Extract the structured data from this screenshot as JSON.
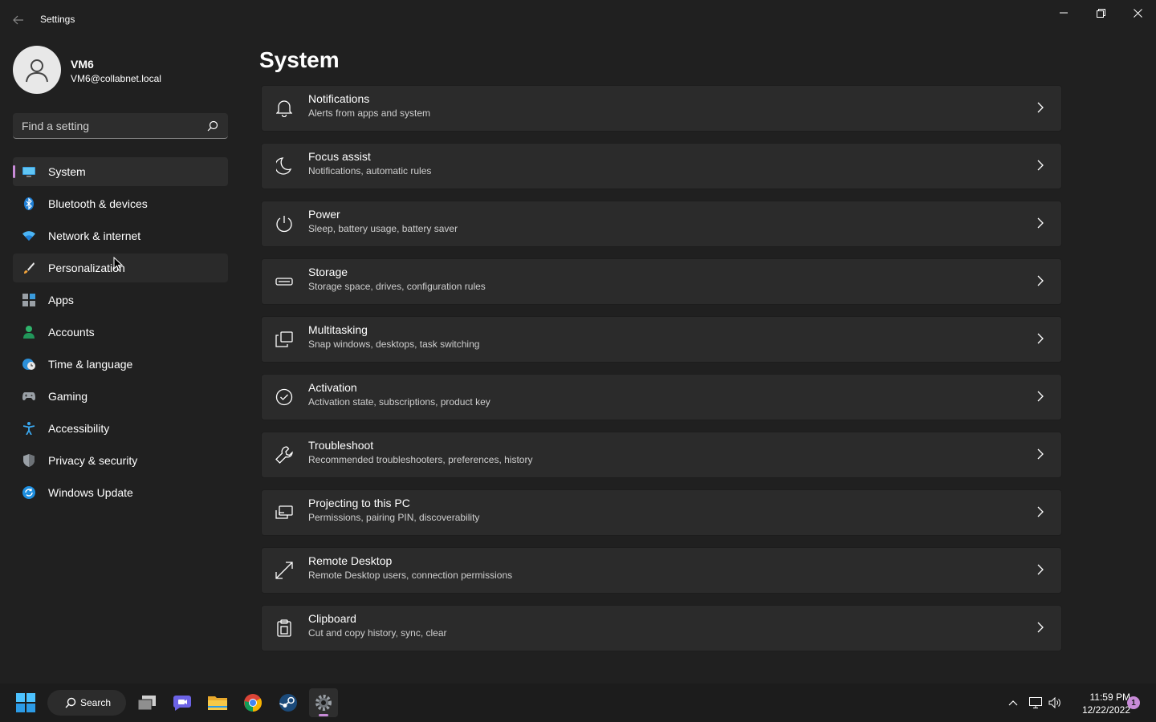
{
  "window": {
    "title": "Settings",
    "back_icon": "arrow-left-icon",
    "controls": [
      "minimize-icon",
      "restore-icon",
      "close-icon"
    ]
  },
  "user": {
    "name": "VM6",
    "email": "VM6@collabnet.local",
    "avatar_icon": "person-icon"
  },
  "search": {
    "placeholder": "Find a setting",
    "value": "",
    "icon": "search-icon"
  },
  "sidebar": {
    "selected": "System",
    "items": [
      {
        "label": "System",
        "icon": "monitor-icon"
      },
      {
        "label": "Bluetooth & devices",
        "icon": "bluetooth-icon"
      },
      {
        "label": "Network & internet",
        "icon": "wifi-icon"
      },
      {
        "label": "Personalization",
        "icon": "brush-icon"
      },
      {
        "label": "Apps",
        "icon": "apps-icon"
      },
      {
        "label": "Accounts",
        "icon": "account-icon"
      },
      {
        "label": "Time & language",
        "icon": "globe-clock-icon"
      },
      {
        "label": "Gaming",
        "icon": "gamepad-icon"
      },
      {
        "label": "Accessibility",
        "icon": "accessibility-icon"
      },
      {
        "label": "Privacy & security",
        "icon": "shield-icon"
      },
      {
        "label": "Windows Update",
        "icon": "update-icon"
      }
    ]
  },
  "main": {
    "title": "System",
    "cards": [
      {
        "title": "Notifications",
        "subtitle": "Alerts from apps and system",
        "icon": "bell-icon"
      },
      {
        "title": "Focus assist",
        "subtitle": "Notifications, automatic rules",
        "icon": "moon-icon"
      },
      {
        "title": "Power",
        "subtitle": "Sleep, battery usage, battery saver",
        "icon": "power-icon"
      },
      {
        "title": "Storage",
        "subtitle": "Storage space, drives, configuration rules",
        "icon": "storage-icon"
      },
      {
        "title": "Multitasking",
        "subtitle": "Snap windows, desktops, task switching",
        "icon": "multitasking-icon"
      },
      {
        "title": "Activation",
        "subtitle": "Activation state, subscriptions, product key",
        "icon": "check-circle-icon"
      },
      {
        "title": "Troubleshoot",
        "subtitle": "Recommended troubleshooters, preferences, history",
        "icon": "wrench-icon"
      },
      {
        "title": "Projecting to this PC",
        "subtitle": "Permissions, pairing PIN, discoverability",
        "icon": "projector-icon"
      },
      {
        "title": "Remote Desktop",
        "subtitle": "Remote Desktop users, connection permissions",
        "icon": "remote-desktop-icon"
      },
      {
        "title": "Clipboard",
        "subtitle": "Cut and copy history, sync, clear",
        "icon": "clipboard-icon"
      }
    ]
  },
  "taskbar": {
    "search_label": "Search",
    "apps": [
      "start-icon",
      "task-view-icon",
      "chat-icon",
      "file-explorer-icon",
      "chrome-icon",
      "steam-icon",
      "settings-icon"
    ],
    "active_app": "settings-icon",
    "tray_icons": [
      "chevron-up-icon",
      "network-icon",
      "volume-icon"
    ],
    "time": "11:59 PM",
    "date": "12/22/2022",
    "notification_count": "1"
  },
  "colors": {
    "background": "#202020",
    "card": "#2b2b2b",
    "accent": "#c88bd8",
    "taskbar": "#1c1c1c"
  }
}
